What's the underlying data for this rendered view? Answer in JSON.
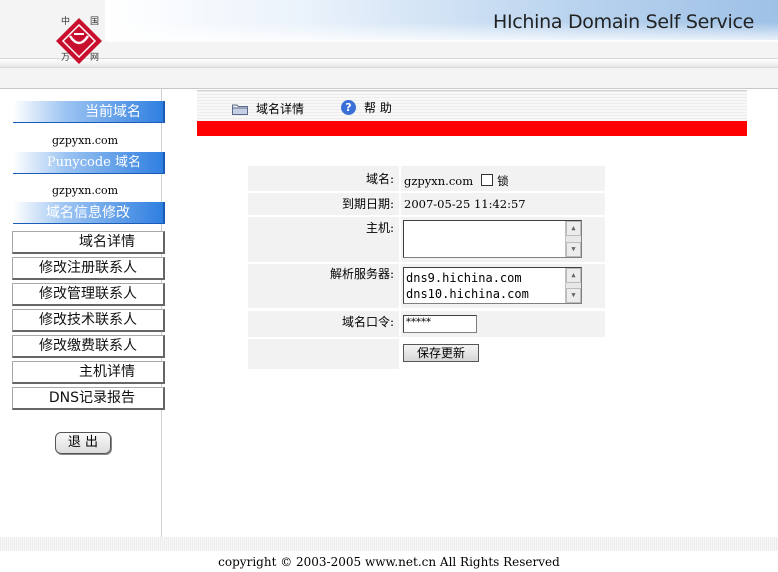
{
  "header": {
    "title": "HIchina Domain Self Service",
    "logo_chars": [
      "中",
      "国",
      "万",
      "网"
    ]
  },
  "sidebar": {
    "current_domain_label": "当前域名",
    "current_domain": "gzpyxn.com",
    "punycode_label": "Punycode 域名",
    "punycode_domain": "gzpyxn.com",
    "modify_label": "域名信息修改",
    "items": [
      {
        "label": "域名详情"
      },
      {
        "label": "修改注册联系人"
      },
      {
        "label": "修改管理联系人"
      },
      {
        "label": "修改技术联系人"
      },
      {
        "label": "修改缴费联系人"
      },
      {
        "label": "主机详情"
      },
      {
        "label": "DNS记录报告"
      }
    ],
    "logout_label": "退 出"
  },
  "toolbar": {
    "domain_detail_label": "域名详情",
    "help_label": "帮 助"
  },
  "form": {
    "domain_label": "域名:",
    "domain_value": "gzpyxn.com",
    "lock_label": "锁",
    "expiry_label": "到期日期:",
    "expiry_value": "2007-05-25 11:42:57",
    "host_label": "主机:",
    "host_value": "",
    "dns_label": "解析服务器:",
    "dns_lines": [
      "dns9.hichina.com",
      "dns10.hichina.com"
    ],
    "password_label": "域名口令:",
    "password_value": "*****",
    "save_label": "保存更新"
  },
  "footer": {
    "copyright": "copyright © 2003-2005 www.net.cn All Rights Reserved"
  },
  "colors": {
    "accent_blue": "#2f7fe0",
    "red_bar": "#ff0000",
    "logo_red": "#c8102e"
  }
}
